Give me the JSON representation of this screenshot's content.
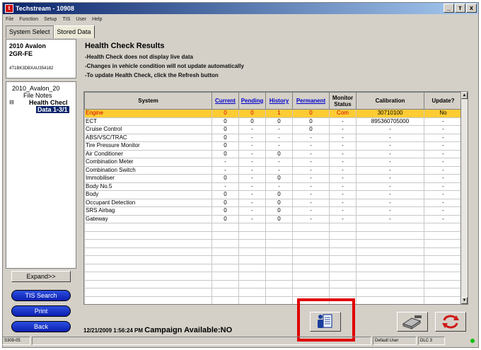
{
  "window": {
    "title": "Techstream - 10908",
    "min": "_",
    "max": "т",
    "close": "x"
  },
  "menu": [
    "File",
    "Function",
    "Setup",
    "TIS",
    "User",
    "Help"
  ],
  "tabs": [
    "System Select",
    "Stored Data"
  ],
  "vehicle": {
    "model": "2010 Avalon",
    "engine": "2GR-FE",
    "vin": "4T1BK3DBXAU354182"
  },
  "tree": {
    "root": "2010_Avalon_20",
    "file_notes": "File Notes",
    "toggle": "⊟",
    "health_check": "Health Checl",
    "selected": "Data 1-3/1"
  },
  "buttons": {
    "expand": "Expand>>",
    "tis_search": "TIS Search",
    "print": "Print",
    "back": "Back"
  },
  "health": {
    "title": "Health Check Results",
    "lines": [
      "-Health Check does not display live data",
      "-Changes in vehicle condition will not update automatically",
      "-To update Health Check, click the Refresh button"
    ]
  },
  "table": {
    "headers": [
      "System",
      "Current",
      "Pending",
      "History",
      "Permanent",
      "Monitor Status",
      "Calibration",
      "Update?"
    ],
    "rows": [
      [
        "Engine",
        "0",
        "0",
        "1",
        "0",
        "Com",
        "30710100",
        "No"
      ],
      [
        "ECT",
        "0",
        "0",
        "0",
        "0",
        "-",
        "895360705000",
        "-"
      ],
      [
        "Cruise Control",
        "0",
        "-",
        "-",
        "0",
        "-",
        "-",
        "-"
      ],
      [
        "ABS/VSC/TRAC",
        "0",
        "-",
        "-",
        "-",
        "-",
        "-",
        "-"
      ],
      [
        "Tire Pressure Monitor",
        "0",
        "-",
        "-",
        "-",
        "-",
        "-",
        "-"
      ],
      [
        "Air Conditioner",
        "0",
        "-",
        "0",
        "-",
        "-",
        "-",
        "-"
      ],
      [
        "Combination Meter",
        "-",
        "-",
        "-",
        "-",
        "-",
        "-",
        "-"
      ],
      [
        "Combination Switch",
        "-",
        "-",
        "-",
        "-",
        "-",
        "-",
        "-"
      ],
      [
        "Immobiliser",
        "0",
        "-",
        "0",
        "-",
        "-",
        "-",
        "-"
      ],
      [
        "Body No.5",
        "-",
        "-",
        "-",
        "-",
        "-",
        "-",
        "-"
      ],
      [
        "Body",
        "0",
        "-",
        "0",
        "-",
        "-",
        "-",
        "-"
      ],
      [
        "Occupant Detection",
        "0",
        "-",
        "0",
        "-",
        "-",
        "-",
        "-"
      ],
      [
        "SRS Airbag",
        "0",
        "-",
        "0",
        "-",
        "-",
        "-",
        "-"
      ],
      [
        "Gateway",
        "0",
        "-",
        "0",
        "-",
        "-",
        "-",
        "-"
      ]
    ],
    "empty_rows": 10
  },
  "footer": {
    "timestamp": "12/21/2009 1:56:24 PM",
    "campaign": "Campaign Available:NO"
  },
  "statusbar": {
    "left": "S309-05",
    "user": "Default User",
    "dlc": "DLC 3"
  },
  "colors": {
    "selected_row": "#ffcc33",
    "highlight": "#e00000",
    "button_blue": "#1a35d0"
  }
}
